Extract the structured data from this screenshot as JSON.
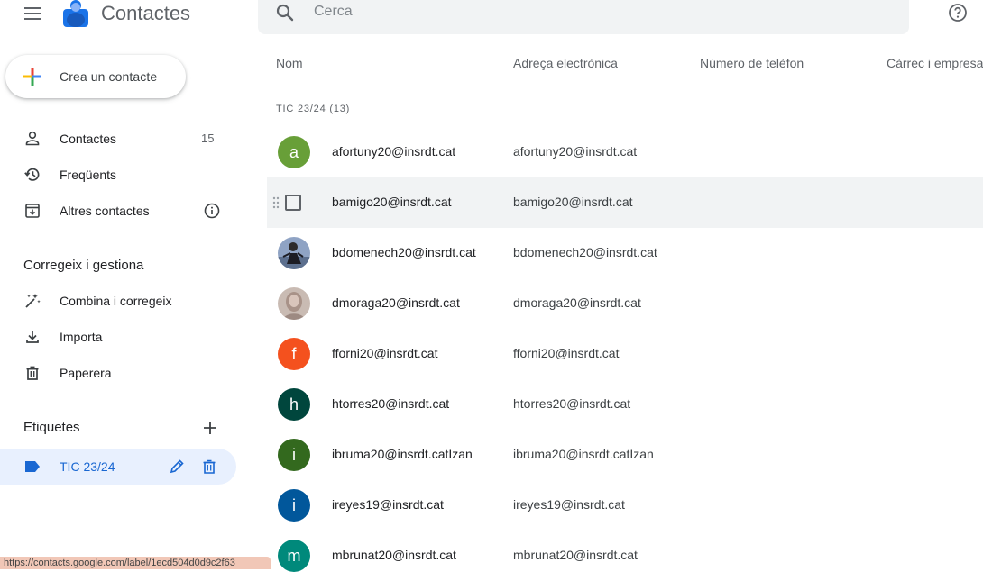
{
  "app": {
    "title": "Contactes"
  },
  "search": {
    "placeholder": "Cerca"
  },
  "sidebar": {
    "create_label": "Crea un contacte",
    "nav": [
      {
        "label": "Contactes",
        "count": "15",
        "icon": "person-icon"
      },
      {
        "label": "Freqüents",
        "icon": "history-icon"
      },
      {
        "label": "Altres contactes",
        "icon": "archive-download-icon"
      }
    ],
    "manage_title": "Corregeix i gestiona",
    "manage": [
      {
        "label": "Combina i corregeix",
        "icon": "magic-wand-icon"
      },
      {
        "label": "Importa",
        "icon": "download-icon"
      },
      {
        "label": "Paperera",
        "icon": "trash-icon"
      }
    ],
    "labels_title": "Etiquetes",
    "labels": [
      {
        "label": "TIC 23/24"
      }
    ]
  },
  "status_url": "https://contacts.google.com/label/1ecd504d0d9c2f63",
  "table": {
    "columns": [
      "Nom",
      "Adreça electrònica",
      "Número de telèfon",
      "Càrrec i empresa"
    ],
    "group": "TIC 23/24 (13)",
    "rows": [
      {
        "initial": "a",
        "color": "#689f38",
        "name": "afortuny20@insrdt.cat",
        "email": "afortuny20@insrdt.cat"
      },
      {
        "initial": "",
        "color": "",
        "name": "bamigo20@insrdt.cat",
        "email": "bamigo20@insrdt.cat"
      },
      {
        "initial": "",
        "color": "#6f7f9a",
        "name": "bdomenech20@insrdt.cat",
        "email": "bdomenech20@insrdt.cat"
      },
      {
        "initial": "",
        "color": "#b8a79e",
        "name": "dmoraga20@insrdt.cat",
        "email": "dmoraga20@insrdt.cat"
      },
      {
        "initial": "f",
        "color": "#f4511e",
        "name": "fforni20@insrdt.cat",
        "email": "fforni20@insrdt.cat"
      },
      {
        "initial": "h",
        "color": "#00463d",
        "name": "htorres20@insrdt.cat",
        "email": "htorres20@insrdt.cat"
      },
      {
        "initial": "i",
        "color": "#33691e",
        "name": "ibruma20@insrdt.catIzan",
        "email": "ibruma20@insrdt.catIzan"
      },
      {
        "initial": "i",
        "color": "#01579b",
        "name": "ireyes19@insrdt.cat",
        "email": "ireyes19@insrdt.cat"
      },
      {
        "initial": "m",
        "color": "#00897b",
        "name": "mbrunat20@insrdt.cat",
        "email": "mbrunat20@insrdt.cat"
      }
    ]
  },
  "colors": {
    "accent": "#1967d2",
    "selected_bg": "#e8f0fe",
    "hover_bg": "#f1f3f4"
  }
}
